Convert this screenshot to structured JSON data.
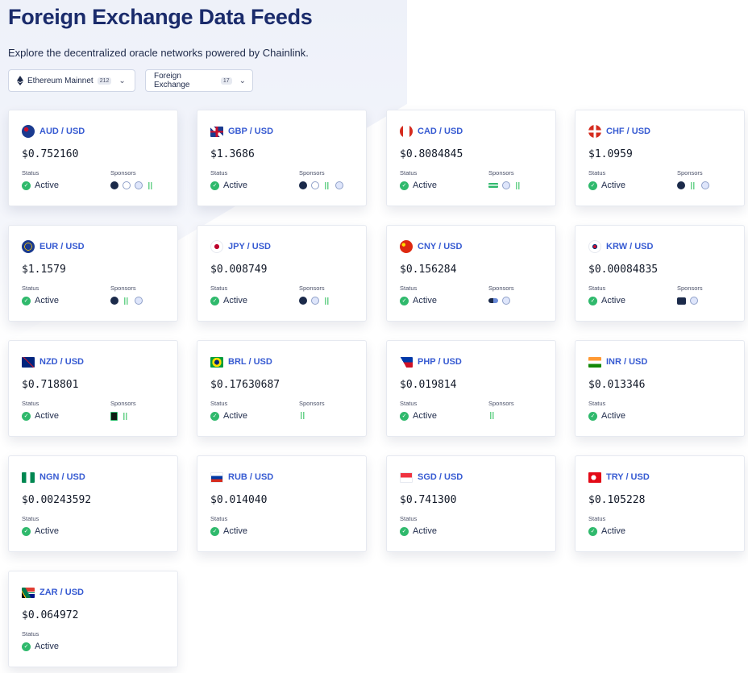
{
  "header": {
    "title": "Foreign Exchange Data Feeds",
    "subtitle": "Explore the decentralized oracle networks powered by Chainlink."
  },
  "filters": {
    "network": {
      "label": "Ethereum Mainnet",
      "count": "212",
      "icon": "ethereum-icon"
    },
    "category": {
      "label": "Foreign Exchange",
      "count": "17"
    }
  },
  "labels": {
    "status": "Status",
    "sponsors": "Sponsors"
  },
  "colors": {
    "accent": "#375bd2",
    "title": "#1a2b6b",
    "active": "#2fb96c"
  },
  "cards": [
    {
      "pair": "AUD / USD",
      "price": "$0.752160",
      "status": "Active",
      "flag": "australia-flag-icon"
    },
    {
      "pair": "GBP / USD",
      "price": "$1.3686",
      "status": "Active",
      "flag": "uk-flag-icon"
    },
    {
      "pair": "CAD / USD",
      "price": "$0.8084845",
      "status": "Active",
      "flag": "canada-flag-icon"
    },
    {
      "pair": "CHF / USD",
      "price": "$1.0959",
      "status": "Active",
      "flag": "switzerland-flag-icon"
    },
    {
      "pair": "EUR / USD",
      "price": "$1.1579",
      "status": "Active",
      "flag": "eu-flag-icon"
    },
    {
      "pair": "JPY / USD",
      "price": "$0.008749",
      "status": "Active",
      "flag": "japan-flag-icon"
    },
    {
      "pair": "CNY / USD",
      "price": "$0.156284",
      "status": "Active",
      "flag": "china-flag-icon"
    },
    {
      "pair": "KRW / USD",
      "price": "$0.00084835",
      "status": "Active",
      "flag": "korea-flag-icon"
    },
    {
      "pair": "NZD / USD",
      "price": "$0.718801",
      "status": "Active",
      "flag": "new-zealand-flag-icon"
    },
    {
      "pair": "BRL / USD",
      "price": "$0.17630687",
      "status": "Active",
      "flag": "brazil-flag-icon"
    },
    {
      "pair": "PHP / USD",
      "price": "$0.019814",
      "status": "Active",
      "flag": "philippines-flag-icon"
    },
    {
      "pair": "INR / USD",
      "price": "$0.013346",
      "status": "Active",
      "flag": "india-flag-icon"
    },
    {
      "pair": "NGN / USD",
      "price": "$0.00243592",
      "status": "Active",
      "flag": "nigeria-flag-icon"
    },
    {
      "pair": "RUB / USD",
      "price": "$0.014040",
      "status": "Active",
      "flag": "russia-flag-icon"
    },
    {
      "pair": "SGD / USD",
      "price": "$0.741300",
      "status": "Active",
      "flag": "singapore-flag-icon"
    },
    {
      "pair": "TRY / USD",
      "price": "$0.105228",
      "status": "Active",
      "flag": "turkey-flag-icon"
    },
    {
      "pair": "ZAR / USD",
      "price": "$0.064972",
      "status": "Active",
      "flag": "south-africa-flag-icon"
    }
  ]
}
